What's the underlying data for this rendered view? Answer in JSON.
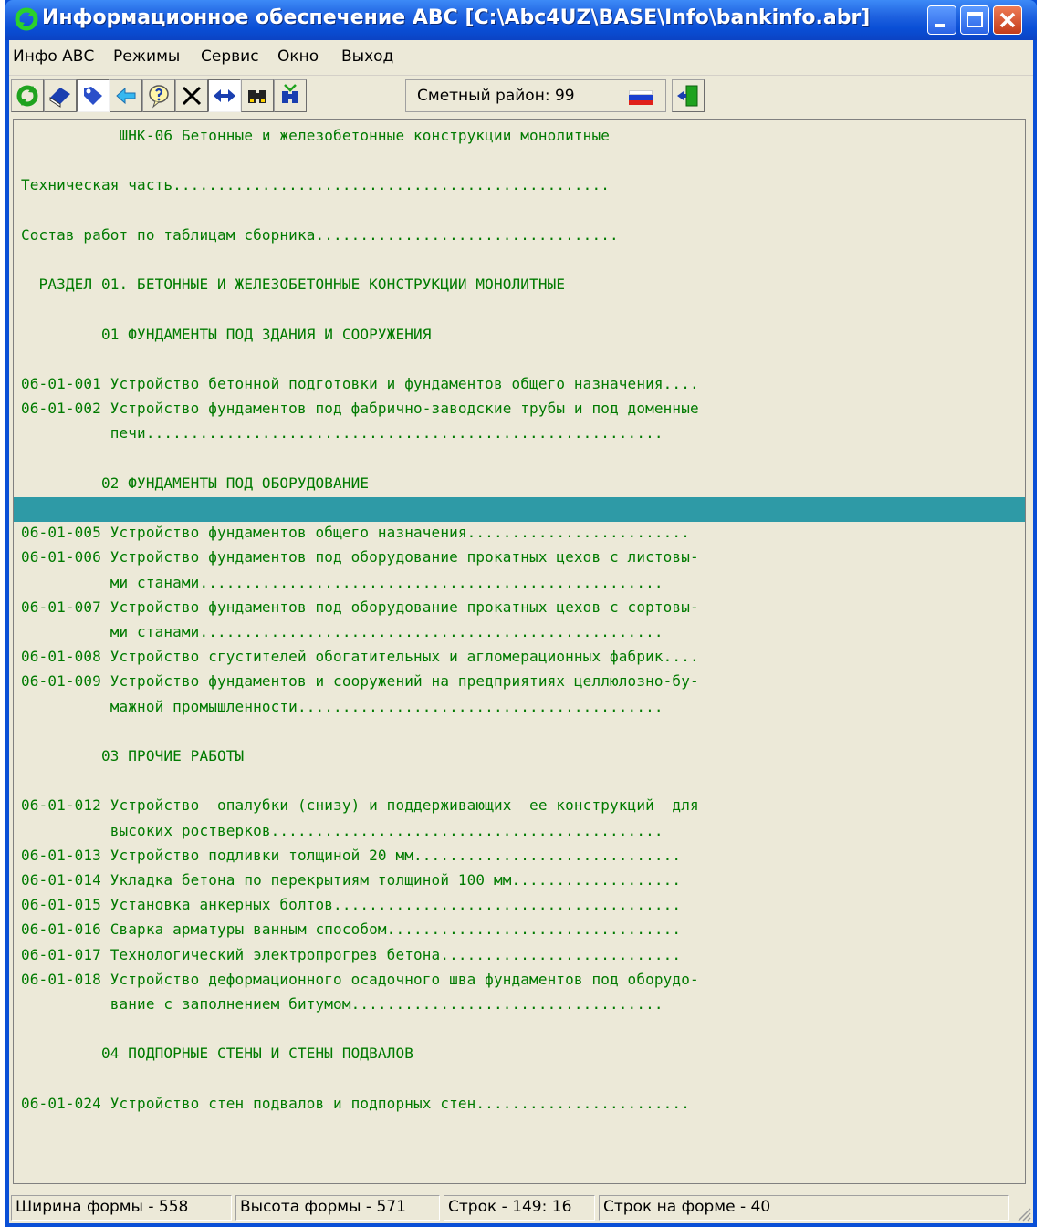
{
  "window": {
    "title": "Информационное обеспечение ABC [C:\\Abc4UZ\\BASE\\Info\\bankinfo.abr]"
  },
  "menu": [
    "Инфо АВС",
    "Режимы",
    "Сервис",
    "Окно",
    "Выход"
  ],
  "toolbar": {
    "region_label": "Сметный район: 99",
    "buttons": [
      "refresh-icon",
      "book-icon",
      "bookmark-icon",
      "back-arrow-icon",
      "help-icon",
      "close-x-icon",
      "expand-icon",
      "binoculars-icon",
      "find-next-icon",
      "exit-door-icon"
    ]
  },
  "content": {
    "lines": [
      "           ШНК-06 Бетонные и железобетонные конструкции монолитные",
      "",
      "Техническая часть.................................................",
      "",
      "Состав работ по таблицам сборника..................................",
      "",
      "  РАЗДЕЛ 01. БЕТОННЫЕ И ЖЕЛЕЗОБЕТОННЫЕ КОНСТРУКЦИИ МОНОЛИТНЫЕ",
      "",
      "         01 ФУНДАМЕНТЫ ПОД ЗДАНИЯ И СООРУЖЕНИЯ",
      "",
      "06-01-001 Устройство бетонной подготовки и фундаментов общего назначения....",
      "06-01-002 Устройство фундаментов под фабрично-заводские трубы и под доменные",
      "          печи..........................................................",
      "",
      "         02 ФУНДАМЕНТЫ ПОД ОБОРУДОВАНИЕ",
      "",
      "06-01-005 Устройство фундаментов общего назначения.........................",
      "06-01-006 Устройство фундаментов под оборудование прокатных цехов с листовы-",
      "          ми станами....................................................",
      "06-01-007 Устройство фундаментов под оборудование прокатных цехов с сортовы-",
      "          ми станами....................................................",
      "06-01-008 Устройство сгустителей обогатительных и агломерационных фабрик....",
      "06-01-009 Устройство фундаментов и сооружений на предприятиях целлюлозно-бу-",
      "          мажной промышленности.........................................",
      "",
      "         03 ПРОЧИЕ РАБОТЫ",
      "",
      "06-01-012 Устройство  опалубки (снизу) и поддерживающих  ее конструкций  для",
      "          высоких ростверков............................................",
      "06-01-013 Устройство подливки толщиной 20 мм..............................",
      "06-01-014 Укладка бетона по перекрытиям толщиной 100 мм...................",
      "06-01-015 Установка анкерных болтов.......................................",
      "06-01-016 Сварка арматуры ванным способом.................................",
      "06-01-017 Технологический электропрогрев бетона...........................",
      "06-01-018 Устройство деформационного осадочного шва фундаментов под оборудо-",
      "          вание с заполнением битумом...................................",
      "",
      "         04 ПОДПОРНЫЕ СТЕНЫ И СТЕНЫ ПОДВАЛОВ",
      "",
      "06-01-024 Устройство стен подвалов и подпорных стен........................"
    ],
    "highlighted_line": 15
  },
  "status": {
    "width": "Ширина формы - 558",
    "height": "Высота формы - 571",
    "rows": "Строк - 149: 16",
    "rows_on_form": "Строк на форме - 40"
  },
  "colors": {
    "text": "#007a00",
    "highlight": "#2e9aa6",
    "background": "#ece9d8",
    "titlebar": "#0a4fd6"
  }
}
